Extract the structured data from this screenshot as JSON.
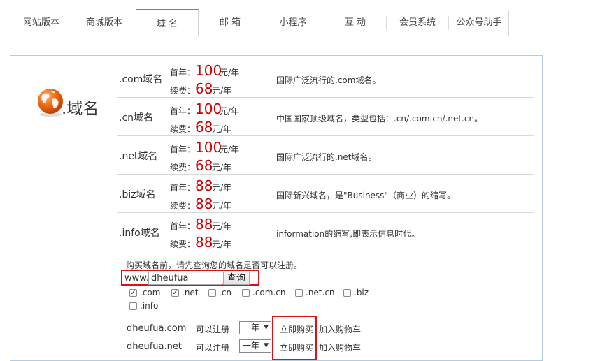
{
  "tabs": [
    "网站版本",
    "商城版本",
    "域  名",
    "邮  箱",
    "小程序",
    "互  动",
    "会员系统",
    "公众号助手"
  ],
  "logo": {
    "text": ".域名",
    "icon": "globe-icon"
  },
  "price_labels": {
    "first": "首年：",
    "renew": "续费：",
    "unit": "元/年"
  },
  "domains": [
    {
      "name": ".com域名",
      "first": "100",
      "renew": "68",
      "desc": "国际广泛流行的.com域名。"
    },
    {
      "name": ".cn域名",
      "first": "100",
      "renew": "68",
      "desc": "中国国家顶级域名，类型包括：.cn/.com.cn/.net.cn。"
    },
    {
      "name": ".net域名",
      "first": "100",
      "renew": "68",
      "desc": "国际广泛流行的.net域名。"
    },
    {
      "name": ".biz域名",
      "first": "88",
      "renew": "88",
      "desc": "国际新兴域名，是\"Business\"（商业）的缩写。"
    },
    {
      "name": ".info域名",
      "first": "88",
      "renew": "88",
      "desc": "information的缩写,即表示信息时代。"
    }
  ],
  "search": {
    "hint": "购买域名前，请先查询您的域名是否可以注册。",
    "prefix": "www.",
    "value": "dheufua",
    "button": "查询"
  },
  "extensions": [
    {
      "label": ".com",
      "checked": true
    },
    {
      "label": ".net",
      "checked": true
    },
    {
      "label": ".cn",
      "checked": false
    },
    {
      "label": ".com.cn",
      "checked": false
    },
    {
      "label": ".net.cn",
      "checked": false
    },
    {
      "label": ".biz",
      "checked": false
    },
    {
      "label": ".info",
      "checked": false
    }
  ],
  "results": [
    {
      "domain": "dheufua.com",
      "status": "可以注册",
      "period": "一年",
      "buy": "立即购买",
      "cart": "加入购物车"
    },
    {
      "domain": "dheufua.net",
      "status": "可以注册",
      "period": "一年",
      "buy": "立即购买",
      "cart": "加入购物车"
    }
  ],
  "colors": {
    "price": "#cc0000",
    "highlight": "#dd1111",
    "tab_active": "#3a8ee6",
    "panel_border": "#b7cbe0"
  }
}
